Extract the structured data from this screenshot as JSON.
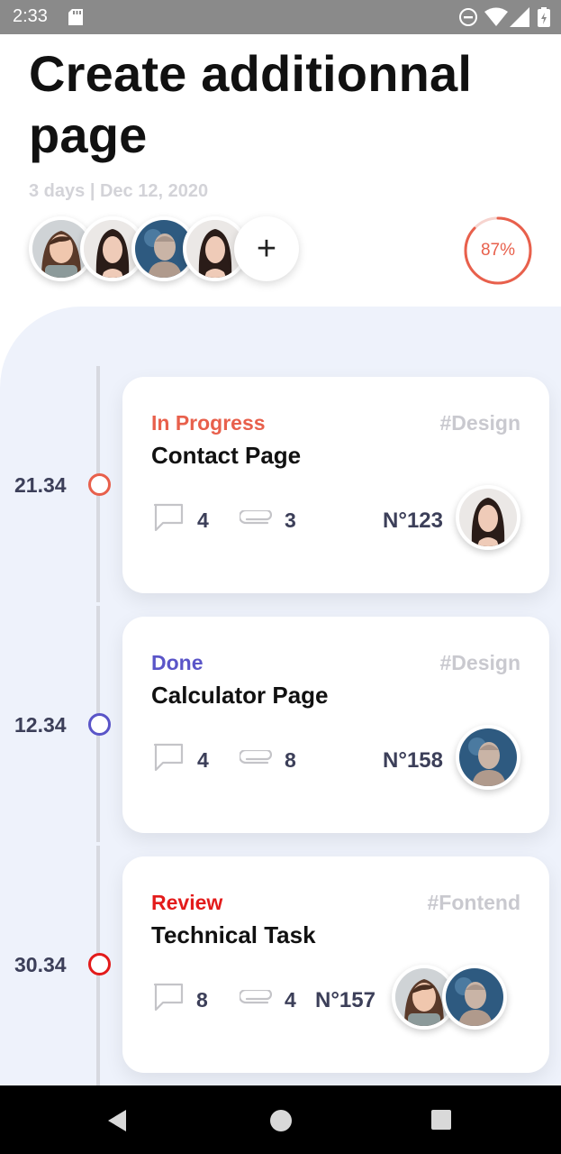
{
  "status_bar": {
    "time": "2:33"
  },
  "header": {
    "title": "Create additionnal page",
    "meta": "3 days | Dec 12, 2020",
    "add_member_label": "+",
    "progress_percent": 87,
    "progress_label": "87%",
    "progress_color": "#e8604c"
  },
  "members": [
    "woman-1",
    "woman-2",
    "man-1",
    "woman-2"
  ],
  "tasks": [
    {
      "time": "21.34",
      "dot_color": "#e8604c",
      "status": "In Progress",
      "status_color": "#e8604c",
      "tag": "#Design",
      "title": "Contact Page",
      "comments": "4",
      "attachments": "3",
      "number": "N°123",
      "assignees": [
        "woman-2"
      ]
    },
    {
      "time": "12.34",
      "dot_color": "#5a55c8",
      "status": "Done",
      "status_color": "#5a55c8",
      "tag": "#Design",
      "title": "Calculator Page",
      "comments": "4",
      "attachments": "8",
      "number": "N°158",
      "assignees": [
        "man-1"
      ]
    },
    {
      "time": "30.34",
      "dot_color": "#e31b1b",
      "status": "Review",
      "status_color": "#e31b1b",
      "tag": "#Fontend",
      "title": "Technical Task",
      "comments": "8",
      "attachments": "4",
      "number": "N°157",
      "assignees": [
        "woman-1",
        "man-1"
      ]
    }
  ]
}
